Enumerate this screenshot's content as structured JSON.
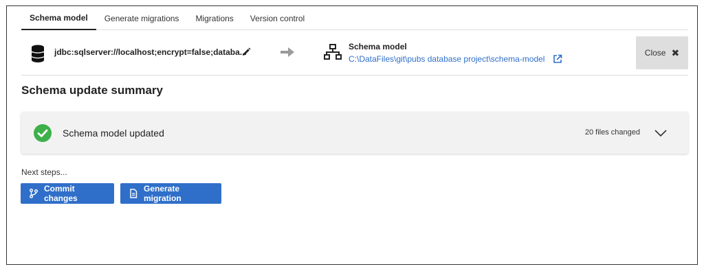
{
  "tabs": [
    {
      "label": "Schema model"
    },
    {
      "label": "Generate migrations"
    },
    {
      "label": "Migrations"
    },
    {
      "label": "Version control"
    }
  ],
  "connection": {
    "source": "jdbc:sqlserver://localhost;encrypt=false;databa...",
    "target_title": "Schema model",
    "target_path": "C:\\DataFiles\\git\\pubs database project\\schema-model"
  },
  "close_label": "Close",
  "summary": {
    "heading": "Schema update summary",
    "status": "Schema model updated",
    "files_changed": "20 files changed"
  },
  "next_steps": {
    "label": "Next steps...",
    "commit_label": "Commit changes",
    "generate_label": "Generate migration"
  },
  "colors": {
    "accent": "#2f6fc9",
    "success": "#3db04a",
    "card_bg": "#f2f2f2"
  }
}
